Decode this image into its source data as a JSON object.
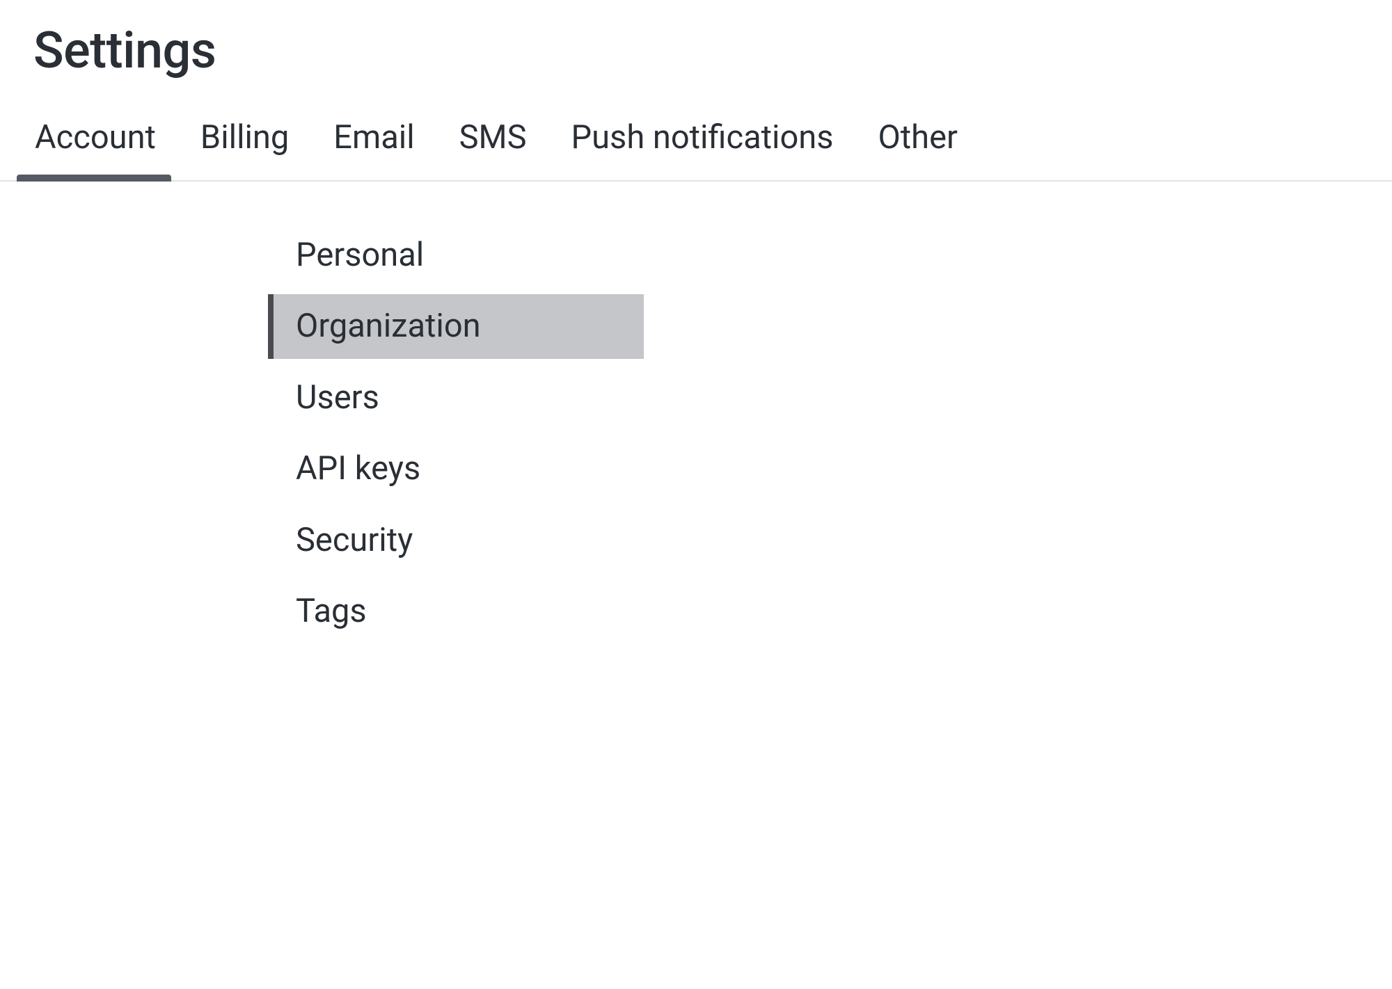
{
  "title": "Settings",
  "tabs": [
    {
      "label": "Account",
      "active": true
    },
    {
      "label": "Billing",
      "active": false
    },
    {
      "label": "Email",
      "active": false
    },
    {
      "label": "SMS",
      "active": false
    },
    {
      "label": "Push notifications",
      "active": false
    },
    {
      "label": "Other",
      "active": false
    }
  ],
  "sidebar": {
    "items": [
      {
        "label": "Personal",
        "active": false
      },
      {
        "label": "Organization",
        "active": true
      },
      {
        "label": "Users",
        "active": false
      },
      {
        "label": "API keys",
        "active": false
      },
      {
        "label": "Security",
        "active": false
      },
      {
        "label": "Tags",
        "active": false
      }
    ]
  }
}
